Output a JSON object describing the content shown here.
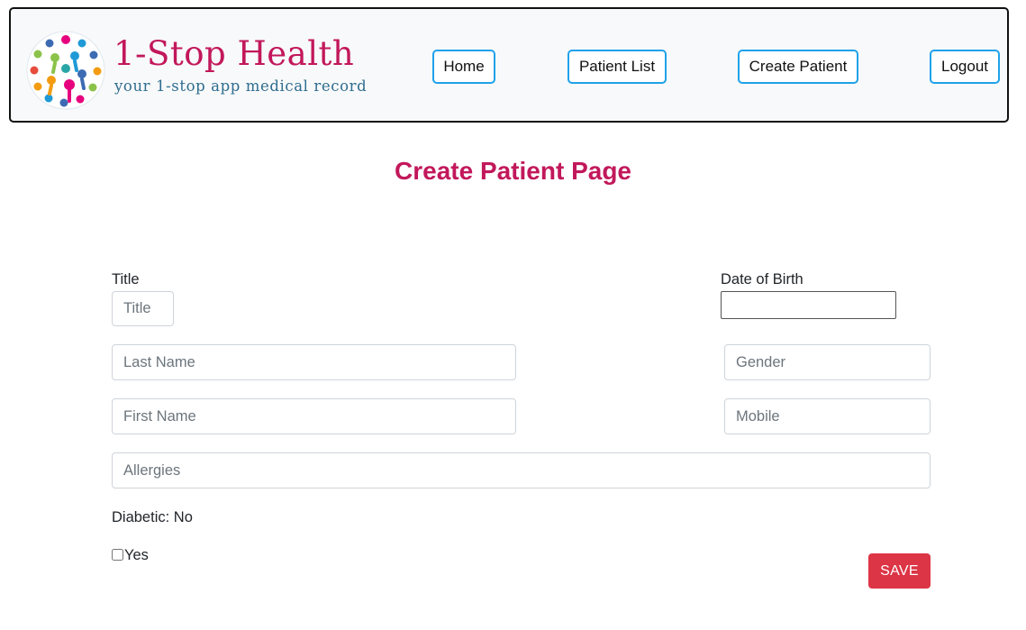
{
  "brand": {
    "title": "1-Stop Health",
    "subtitle": "your 1-stop app medical record"
  },
  "nav": {
    "home": "Home",
    "patient_list": "Patient List",
    "create_patient": "Create Patient",
    "logout": "Logout"
  },
  "page": {
    "title": "Create Patient Page"
  },
  "form": {
    "title_label": "Title",
    "title_placeholder": "Title",
    "dob_label": "Date of Birth",
    "dob_value": "",
    "last_name_placeholder": "Last Name",
    "gender_placeholder": "Gender",
    "first_name_placeholder": "First Name",
    "mobile_placeholder": "Mobile",
    "allergies_placeholder": "Allergies",
    "diabetic_status": "Diabetic: No",
    "yes_label": "Yes",
    "yes_checked": false,
    "save_label": "SAVE"
  },
  "colors": {
    "brand": "#c2185b",
    "subtitle": "#2f6d8f",
    "nav_border": "#1fa2ea",
    "save": "#dc3545"
  }
}
